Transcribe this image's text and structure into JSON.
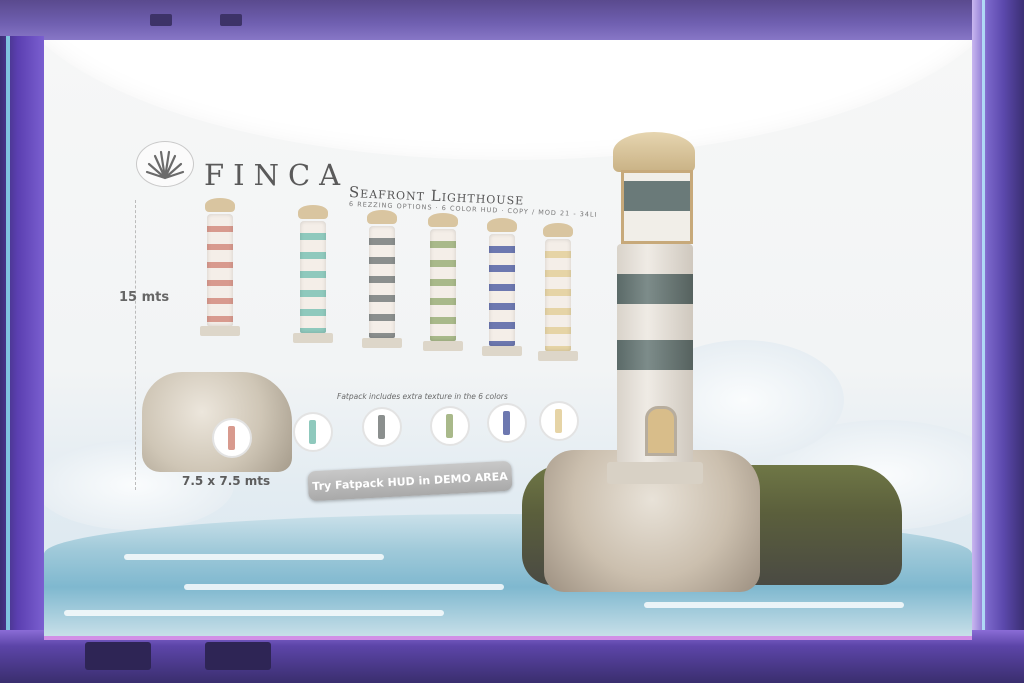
{
  "sign": {
    "brand": "FINCA",
    "title": "Seafront Lighthouse",
    "subtitle": "6 REZZING OPTIONS · 6 COLOR HUD · COPY / MOD 21 - 34LI",
    "height_label": "15 mts",
    "footprint_label": "7.5 x 7.5 mts",
    "fatpack_note": "Fatpack includes extra texture in the 6 colors",
    "demo_button": "Try Fatpack HUD in DEMO AREA"
  },
  "icons": {
    "logo": "agave-plant-icon"
  },
  "colors": {
    "frame": "#6f5fb0",
    "accent_edge": "#d28fe6",
    "lighthouse_variants": [
      "#d89a8e",
      "#8fc9bd",
      "#8b8f8e",
      "#a9b98a",
      "#6d78b0",
      "#e6d4a6"
    ],
    "big_lighthouse_band": "#6a7a79"
  }
}
